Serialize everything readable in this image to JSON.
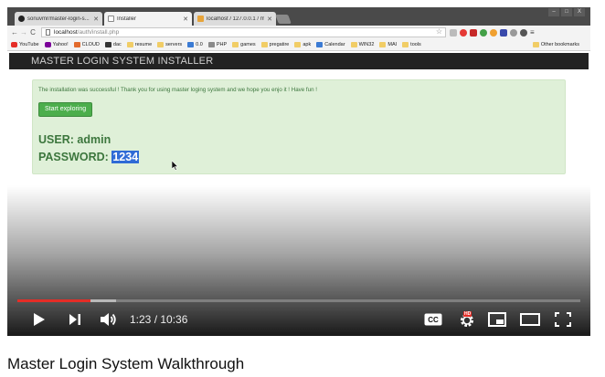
{
  "browser": {
    "tabs": [
      {
        "label": "sonuvmr/master-login-s...",
        "icon": "github-icon"
      },
      {
        "label": "Installer",
        "icon": "page-icon",
        "active": true
      },
      {
        "label": "localhost / 127.0.0.1 / mlo...",
        "icon": "phpmyadmin-icon"
      }
    ],
    "window_controls": [
      "–",
      "□",
      "X"
    ],
    "address": {
      "host": "localhost",
      "path": "/auth/install.php"
    },
    "bookmarks": [
      {
        "label": "YouTube",
        "icon": "yt"
      },
      {
        "label": "Yahoo!",
        "icon": "yahoo"
      },
      {
        "label": "CLOUD",
        "icon": "cloud"
      },
      {
        "label": "dac",
        "icon": "dac"
      },
      {
        "label": "resume",
        "icon": "folder"
      },
      {
        "label": "servers",
        "icon": "folder"
      },
      {
        "label": "0.0",
        "icon": "blue"
      },
      {
        "label": "PHP",
        "icon": "grey"
      },
      {
        "label": "games",
        "icon": "folder"
      },
      {
        "label": "pregatire",
        "icon": "folder"
      },
      {
        "label": "apk",
        "icon": "folder"
      },
      {
        "label": "Calendar",
        "icon": "blue"
      },
      {
        "label": "WIN32",
        "icon": "folder"
      },
      {
        "label": "MAI",
        "icon": "folder"
      },
      {
        "label": "tools",
        "icon": "folder"
      }
    ],
    "other_bookmarks": "Other bookmarks"
  },
  "page": {
    "brand": "MASTER LOGIN SYSTEM INSTALLER",
    "success_message": "The installation was successful ! Thank you for using master loging system and we hope you enjo it ! Have fun !",
    "start_button": "Start exploring",
    "user_label": "USER:",
    "user_value": "admin",
    "password_label": "PASSWORD:",
    "password_value": "1234"
  },
  "player": {
    "current_time": "1:23",
    "duration": "10:36",
    "time_display": "1:23 / 10:36",
    "played_fraction": 0.13,
    "buffered_fraction": 0.175,
    "hd_badge": "HD",
    "accent_color": "#e52d27"
  },
  "video_title": "Master Login System Walkthrough"
}
